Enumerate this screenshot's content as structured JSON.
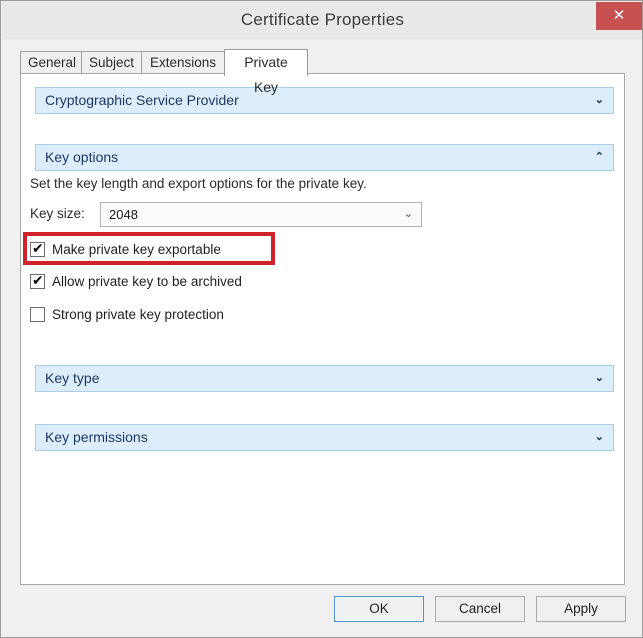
{
  "window": {
    "title": "Certificate Properties",
    "close_label": "✕"
  },
  "tabs": [
    {
      "label": "General",
      "active": false
    },
    {
      "label": "Subject",
      "active": false
    },
    {
      "label": "Extensions",
      "active": false
    },
    {
      "label": "Private Key",
      "active": true
    }
  ],
  "sections": {
    "csp": {
      "label": "Cryptographic Service Provider",
      "chevron": "⌄",
      "expanded": false
    },
    "key_options": {
      "label": "Key options",
      "chevron": "⌃",
      "expanded": true,
      "description": "Set the key length and export options for the private key.",
      "key_size": {
        "label": "Key size:",
        "value": "2048",
        "chevron": "⌄"
      },
      "checkboxes": [
        {
          "label": "Make private key exportable",
          "checked": true,
          "mark": "✔"
        },
        {
          "label": "Allow private key to be archived",
          "checked": true,
          "mark": "✔"
        },
        {
          "label": "Strong private key protection",
          "checked": false,
          "mark": ""
        }
      ]
    },
    "key_type": {
      "label": "Key type",
      "chevron": "⌄",
      "expanded": false
    },
    "key_permissions": {
      "label": "Key permissions",
      "chevron": "⌄",
      "expanded": false
    }
  },
  "annotation": {
    "color": "#d0222b",
    "targets": "Make private key exportable"
  },
  "buttons": {
    "ok": "OK",
    "cancel": "Cancel",
    "apply": "Apply"
  },
  "colors": {
    "titlebar": "#e9e9e9",
    "close": "#c75050",
    "section_header_bg": "#dceefc",
    "section_header_border": "#a9cfe8",
    "section_text": "#1f3864",
    "dialog_bg": "#f0f0f0",
    "panel_bg": "#ffffff",
    "annotation": "#d0222b",
    "default_button_border": "#4b93d1"
  }
}
